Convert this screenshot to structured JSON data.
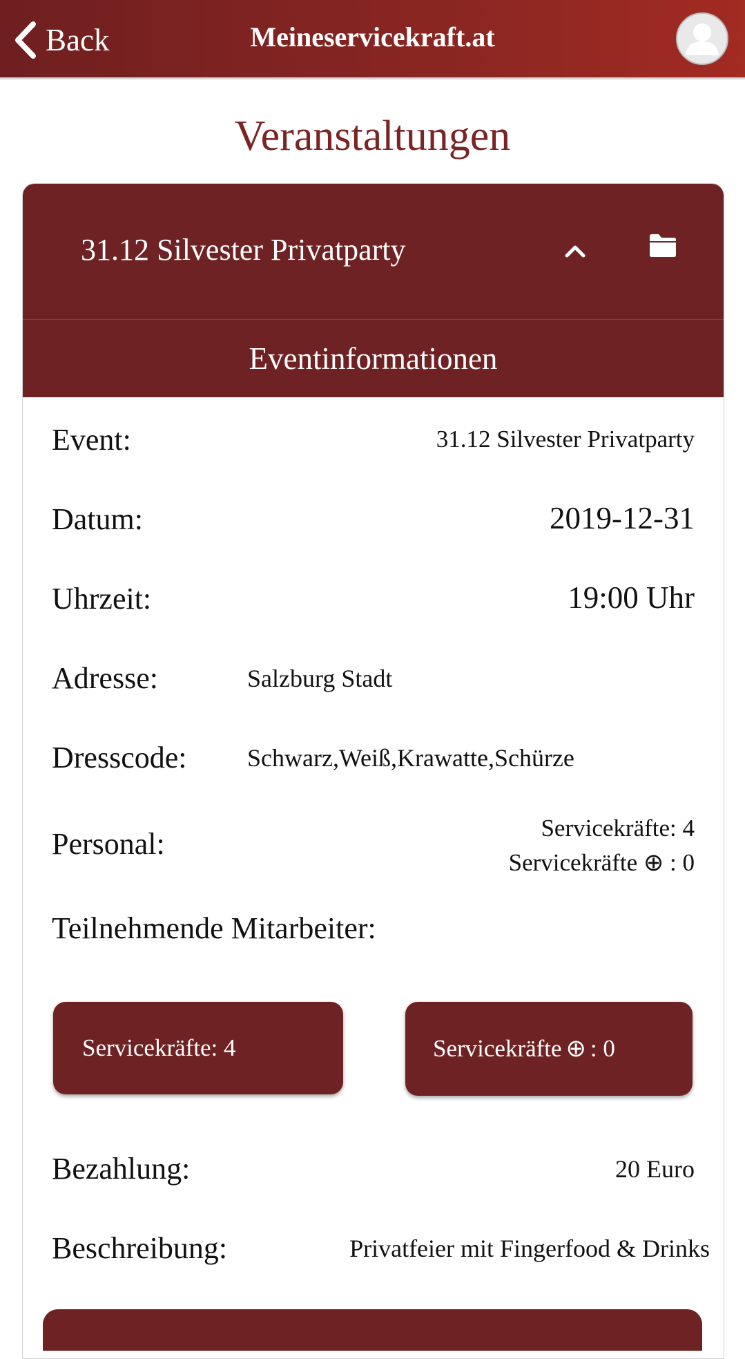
{
  "topbar": {
    "back_label": "Back",
    "brand": "Meineservicekraft.at"
  },
  "page": {
    "title": "Veranstaltungen"
  },
  "event_card": {
    "title": "31.12 Silvester Privatparty",
    "section_title": "Eventinformationen",
    "rows": {
      "event": {
        "label": "Event:",
        "value": "31.12 Silvester Privatparty"
      },
      "datum": {
        "label": "Datum:",
        "value": "2019-12-31"
      },
      "uhrzeit": {
        "label": "Uhrzeit:",
        "value": "19:00 Uhr"
      },
      "adresse": {
        "label": "Adresse:",
        "value": "Salzburg Stadt"
      },
      "dresscode": {
        "label": "Dresscode:",
        "value": "Schwarz,Weiß,Krawatte,Schürze"
      },
      "personal": {
        "label": "Personal:",
        "line1": "Servicekräfte: 4",
        "line2_prefix": "Servicekräfte",
        "line2_symbol": "⊕",
        "line2_suffix": ": 0"
      },
      "teilnehmende": {
        "label": "Teilnehmende Mitarbeiter:"
      },
      "bezahlung": {
        "label": "Bezahlung:",
        "value": "20 Euro"
      },
      "beschreibung": {
        "label": "Beschreibung:",
        "value": "Privatfeier mit Fingerfood & Drinks"
      }
    },
    "buttons": {
      "servicekraefte": "Servicekräfte: 4",
      "servicekraefte_plus_prefix": "Servicekräfte",
      "servicekraefte_plus_symbol": "⊕",
      "servicekraefte_plus_suffix": ": 0"
    }
  },
  "colors": {
    "brand_dark": "#6f2224",
    "title_red": "#7a2424"
  },
  "icons": [
    "chevron-left-icon",
    "user-avatar-icon",
    "chevron-up-icon",
    "folder-icon"
  ]
}
